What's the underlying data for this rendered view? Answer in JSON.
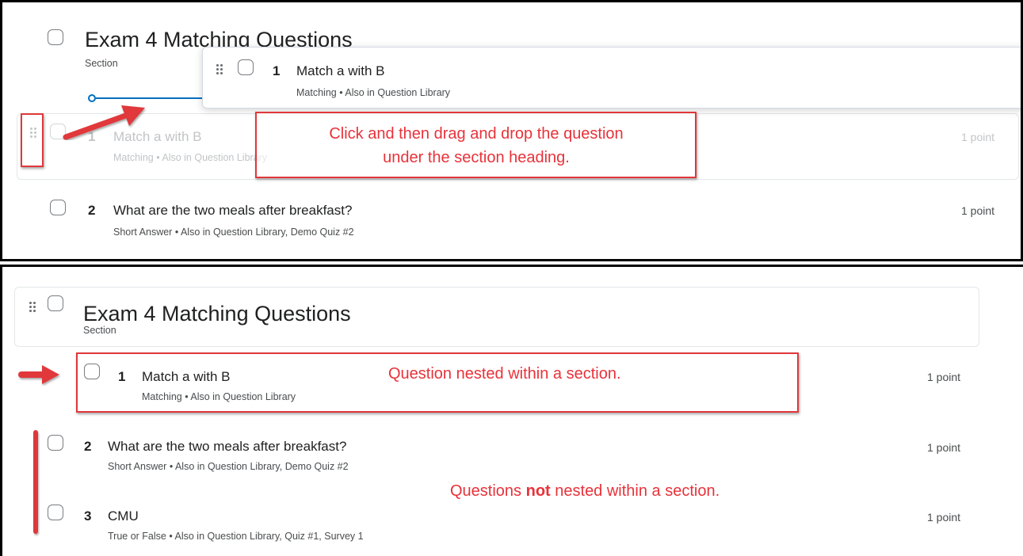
{
  "top_panel": {
    "section": {
      "title": "Exam 4 Matching Questions",
      "type_label": "Section"
    },
    "drag_card": {
      "number": "1",
      "title": "Match a with B",
      "meta": "Matching • Also in Question Library"
    },
    "ghost_row": {
      "number": "1",
      "title": "Match a with B",
      "meta": "Matching • Also in Question Library",
      "points": "1 point"
    },
    "callout": {
      "line1": "Click and then drag and drop the question",
      "line2": "under the section heading."
    },
    "question2": {
      "number": "2",
      "title": "What are the two meals after breakfast?",
      "meta": "Short Answer • Also in Question Library, Demo Quiz #2",
      "points": "1 point"
    }
  },
  "bottom_panel": {
    "section": {
      "title": "Exam 4 Matching Questions",
      "type_label": "Section"
    },
    "question1": {
      "number": "1",
      "title": "Match a with B",
      "meta": "Matching • Also in Question Library",
      "points": "1 point"
    },
    "nested_note": "Question nested within a section.",
    "question2": {
      "number": "2",
      "title": "What are the two meals after breakfast?",
      "meta": "Short Answer • Also in Question Library, Demo Quiz #2",
      "points": "1 point"
    },
    "not_nested_note": {
      "before": "Questions ",
      "bold": "not",
      "after": " nested within a section."
    },
    "question3": {
      "number": "3",
      "title": "CMU",
      "meta": "True or False • Also in Question Library, Quiz #1, Survey 1",
      "points": "1 point"
    }
  },
  "colors": {
    "annotation_red": "#e0373b",
    "accent_blue": "#006fbf",
    "border": "#000000"
  },
  "icons": [
    "drag-handle-icon",
    "checkbox-icon",
    "arrow-icon"
  ]
}
